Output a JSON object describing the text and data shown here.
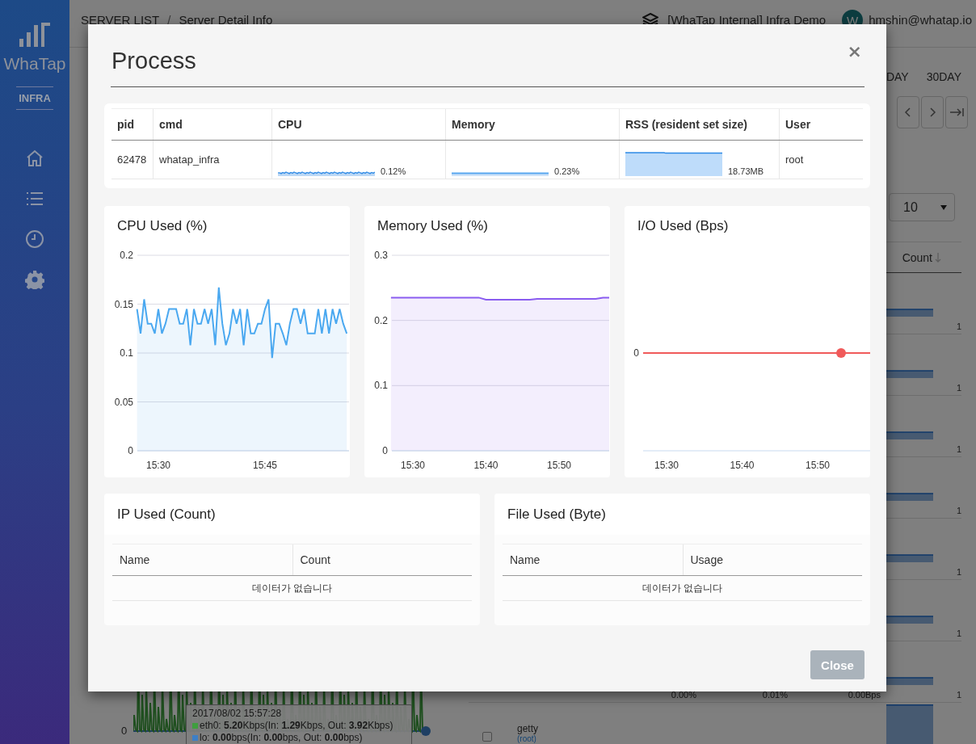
{
  "sidebar": {
    "logo_text": "WhaTap",
    "product": "INFRA"
  },
  "header": {
    "breadcrumb": [
      "SERVER LIST",
      "Server Detail Info"
    ],
    "separator": "/",
    "workspace": "[WhaTap Internal] Infra Demo",
    "avatar_letter": "W",
    "user_email": "hmshin@whatap.io"
  },
  "range_options": [
    "DAY",
    "30DAY"
  ],
  "page_size": "10",
  "server_table": {
    "sort_column": "Count",
    "rows": [
      {
        "count": "1"
      },
      {
        "count": "1"
      },
      {
        "count": "1"
      },
      {
        "count": "1"
      },
      {
        "count": "1"
      },
      {
        "count": "1"
      },
      {
        "cpu": "0.00%",
        "memory": "0.01%",
        "network": "0.00Bps",
        "count": "1"
      },
      {
        "name": "getty",
        "user": "(root)",
        "checked": false
      }
    ]
  },
  "network_chart": {
    "y_label": "0",
    "tooltip": {
      "time": "2017/08/02 15:57:28",
      "series": [
        {
          "color": "#3f9e3f",
          "text": "eth0: **5.20**Kbps(In: **1.29**Kbps, Out: **3.92**Kbps)"
        },
        {
          "color": "#3d7fc6",
          "text": "lo: **0.00**bps(In: **0.00**bps, Out: **0.00**bps)"
        }
      ]
    }
  },
  "modal": {
    "title": "Process",
    "close_icon": "×",
    "process_table": {
      "columns": [
        "pid",
        "cmd",
        "CPU",
        "Memory",
        "RSS (resident set size)",
        "User"
      ],
      "rows": [
        {
          "pid": "62478",
          "cmd": "whatap_infra",
          "cpu": "0.12%",
          "memory": "0.23%",
          "rss": "18.73MB",
          "user": "root"
        }
      ]
    },
    "charts": [
      {
        "title": "CPU Used (%)",
        "chart_data": {
          "type": "area",
          "grid": true,
          "ylim": [
            0,
            0.2
          ],
          "yticks": [
            0,
            0.05,
            0.1,
            0.15,
            0.2
          ],
          "categories": [
            null,
            null,
            null,
            null,
            null,
            null,
            "15:30",
            null,
            null,
            null,
            null,
            null,
            null,
            null,
            null,
            null,
            null,
            null,
            null,
            null,
            null,
            null,
            null,
            null,
            null,
            null,
            null,
            null,
            null,
            null,
            null,
            null,
            null,
            null,
            null,
            null,
            "15:45",
            null,
            null,
            null,
            null,
            null,
            null,
            null,
            null,
            null,
            null,
            null,
            null,
            null,
            null,
            null,
            null,
            null,
            null,
            null,
            null,
            null,
            null,
            null
          ],
          "series": [
            {
              "color": "#4aa8f0",
              "values": [
                0.145,
                0.12,
                0.155,
                0.13,
                0.13,
                0.12,
                0.145,
                0.12,
                0.13,
                0.145,
                0.145,
                0.145,
                0.13,
                0.13,
                0.145,
                0.108,
                0.145,
                0.13,
                0.13,
                0.145,
                0.13,
                0.145,
                0.108,
                0.167,
                0.13,
                0.108,
                0.12,
                0.145,
                0.13,
                0.145,
                0.108,
                0.145,
                0.12,
                0.12,
                0.13,
                0.13,
                0.145,
                0.155,
                0.095,
                0.13,
                0.13,
                0.12,
                0.108,
                0.13,
                0.145,
                0.145,
                0.13,
                0.145,
                0.12,
                0.12,
                0.12,
                0.145,
                0.12,
                0.145,
                0.12,
                0.145,
                0.13,
                0.145,
                0.13,
                0.12
              ]
            }
          ]
        }
      },
      {
        "title": "Memory Used (%)",
        "chart_data": {
          "type": "area",
          "grid": true,
          "ylim": [
            0,
            0.3
          ],
          "yticks": [
            0,
            0.1,
            0.2,
            0.3
          ],
          "categories": [
            null,
            null,
            null,
            "15:30",
            null,
            null,
            null,
            null,
            null,
            null,
            null,
            null,
            null,
            "15:40",
            null,
            null,
            null,
            null,
            null,
            null,
            null,
            null,
            null,
            "15:50",
            null,
            null,
            null,
            null,
            null,
            null,
            null
          ],
          "series": [
            {
              "color": "#8a5cf0",
              "values": [
                0.235,
                0.235,
                0.235,
                0.235,
                0.235,
                0.235,
                0.235,
                0.235,
                0.235,
                0.235,
                0.235,
                0.235,
                0.235,
                0.232,
                0.232,
                0.232,
                0.232,
                0.232,
                0.232,
                0.232,
                0.233,
                0.233,
                0.233,
                0.233,
                0.233,
                0.233,
                0.233,
                0.233,
                0.233,
                0.235,
                0.235
              ]
            }
          ]
        }
      },
      {
        "title": "I/O Used (Bps)",
        "y_label": "0",
        "x_labels": [
          "15:30",
          "15:40",
          "15:50"
        ]
      }
    ],
    "tables": [
      {
        "title": "IP Used (Count)",
        "columns": [
          "Name",
          "Count"
        ],
        "empty_text": "데이터가 없습니다"
      },
      {
        "title": "File Used (Byte)",
        "columns": [
          "Name",
          "Usage"
        ],
        "empty_text": "데이터가 없습니다"
      }
    ],
    "close_button": "Close"
  }
}
